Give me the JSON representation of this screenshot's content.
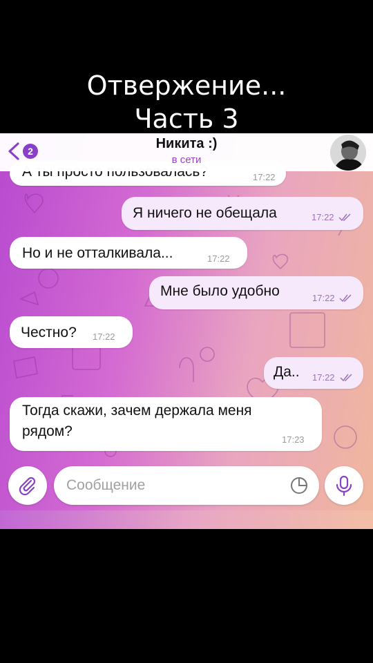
{
  "overlay": {
    "line1": "Отвержение...",
    "line2": "Часть 3"
  },
  "header": {
    "back_badge": "2",
    "contact_name": "Никита :)",
    "status": "в сети"
  },
  "messages": [
    {
      "direction": "in",
      "text": "А ты просто пользовалась?",
      "time": "17:22"
    },
    {
      "direction": "out",
      "text": "Я ничего не обещала",
      "time": "17:22",
      "read": true
    },
    {
      "direction": "in",
      "text": "Но и не отталкивала...",
      "time": "17:22"
    },
    {
      "direction": "out",
      "text": "Мне было удобно",
      "time": "17:22",
      "read": true
    },
    {
      "direction": "in",
      "text": "Честно?",
      "time": "17:22"
    },
    {
      "direction": "out",
      "text": "Да..",
      "time": "17:22",
      "read": true
    },
    {
      "direction": "in",
      "text_line1": "Тогда скажи, зачем держала меня",
      "text_line2": "рядом?",
      "time": "17:23"
    }
  ],
  "composer": {
    "placeholder": "Сообщение"
  },
  "colors": {
    "accent": "#8a3fc9",
    "status": "#9a3fd0",
    "outgoing_bubble": "#f6e9fb"
  },
  "icons": [
    "chevron-left-icon",
    "paperclip-icon",
    "sticker-icon",
    "microphone-icon",
    "double-check-icon"
  ]
}
